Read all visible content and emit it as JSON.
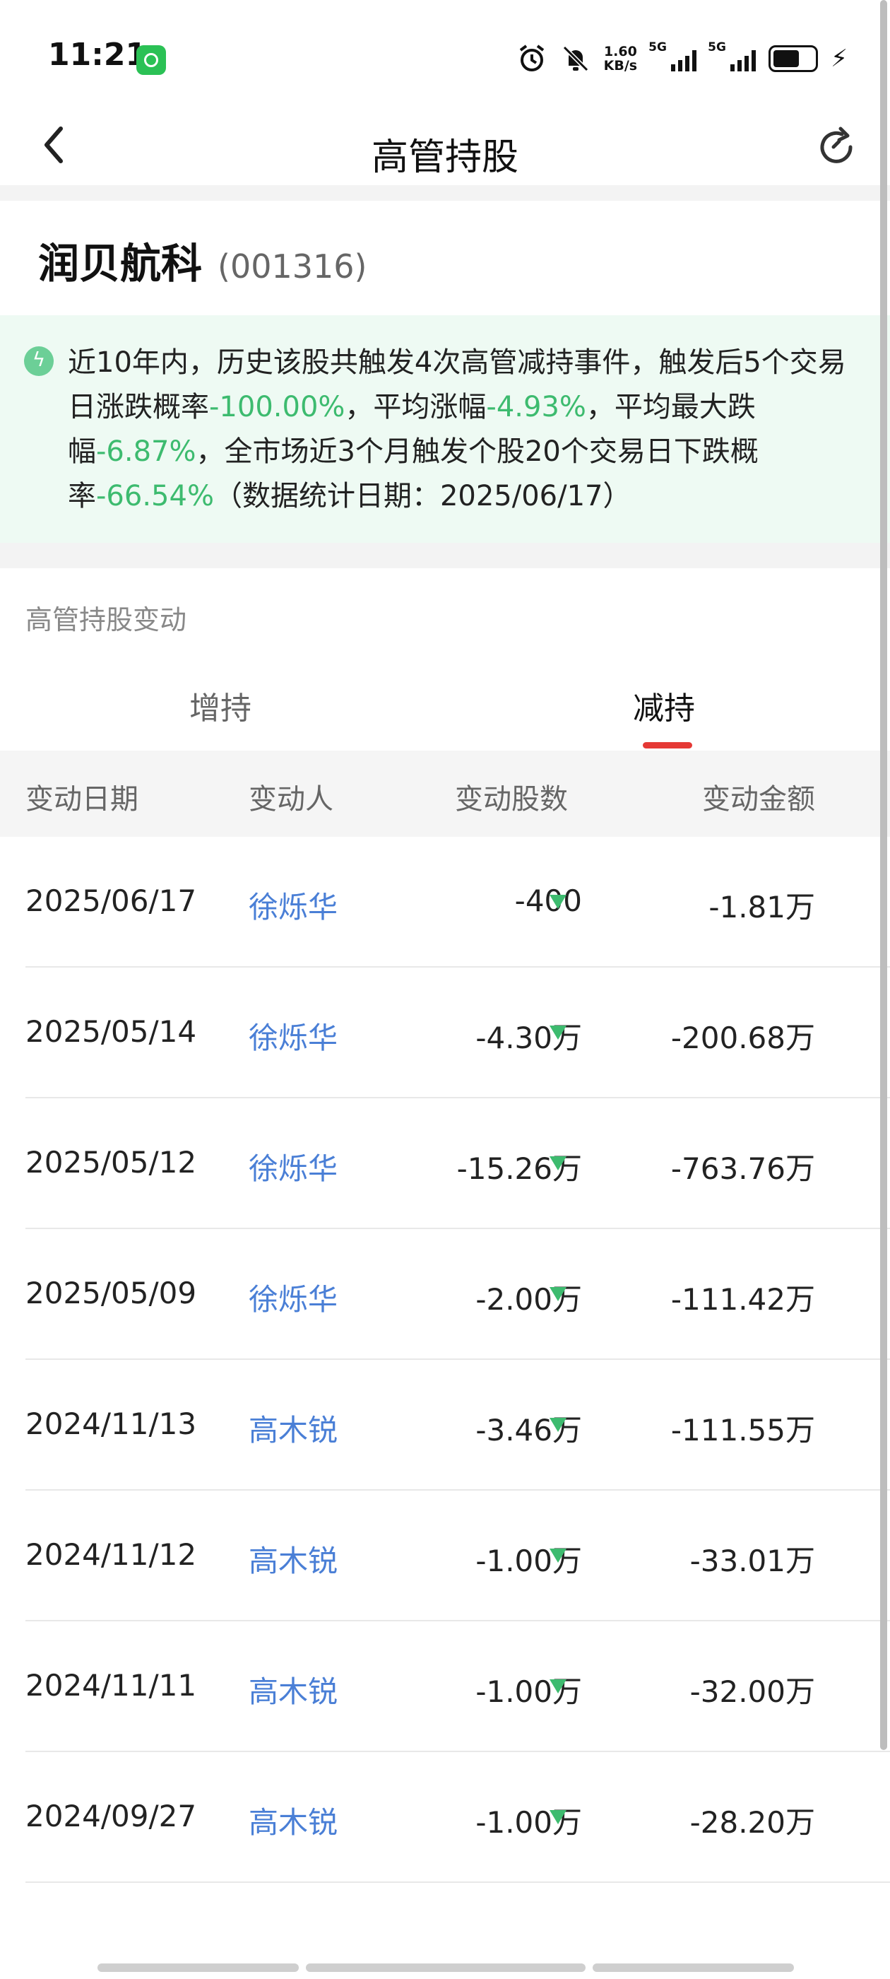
{
  "status_bar": {
    "time": "11:21",
    "speed_top": "1.60",
    "speed_bottom": "KB/s",
    "signal1_label": "5G",
    "signal2_label": "5G"
  },
  "nav": {
    "title": "高管持股"
  },
  "stock": {
    "name": "润贝航科",
    "code": "(001316)"
  },
  "notice": {
    "icon": "lightning-icon",
    "t1": "近10年内，历史该股共触发4次高管减持事件，触发后5个交易日涨跌概率",
    "v1": "-100.00%",
    "t2": "，平均涨幅",
    "v2": "-4.93%",
    "t3": "，平均最大跌幅",
    "v3": "-6.87%",
    "t4": "，全市场近3个月触发个股20个交易日下跌概率",
    "v4": "-66.54%",
    "t5": "（数据统计日期：2025/06/17）"
  },
  "section": {
    "title": "高管持股变动"
  },
  "tabs": {
    "increase": "增持",
    "decrease": "减持",
    "active": "decrease"
  },
  "table": {
    "headers": {
      "date": "变动日期",
      "person": "变动人",
      "shares": "变动股数",
      "amount": "变动金额"
    },
    "rows": [
      {
        "date": "2025/06/17",
        "person": "徐烁华",
        "shares": "-400",
        "amount": "-1.81万"
      },
      {
        "date": "2025/05/14",
        "person": "徐烁华",
        "shares": "-4.30万",
        "amount": "-200.68万"
      },
      {
        "date": "2025/05/12",
        "person": "徐烁华",
        "shares": "-15.26万",
        "amount": "-763.76万"
      },
      {
        "date": "2025/05/09",
        "person": "徐烁华",
        "shares": "-2.00万",
        "amount": "-111.42万"
      },
      {
        "date": "2024/11/13",
        "person": "高木锐",
        "shares": "-3.46万",
        "amount": "-111.55万"
      },
      {
        "date": "2024/11/12",
        "person": "高木锐",
        "shares": "-1.00万",
        "amount": "-33.01万"
      },
      {
        "date": "2024/11/11",
        "person": "高木锐",
        "shares": "-1.00万",
        "amount": "-32.00万"
      },
      {
        "date": "2024/09/27",
        "person": "高木锐",
        "shares": "-1.00万",
        "amount": "-28.20万"
      }
    ]
  },
  "colors": {
    "down_green": "#3dbb6f",
    "person_blue": "#4a7fd6",
    "tab_underline_red": "#e53935"
  }
}
